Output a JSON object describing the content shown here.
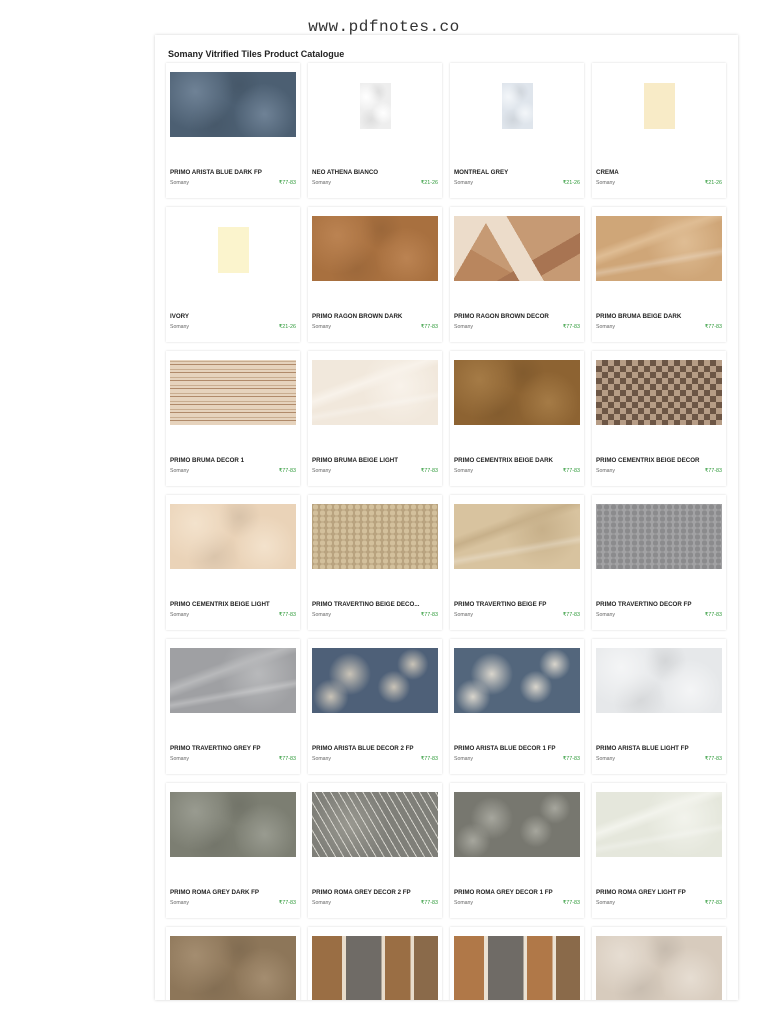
{
  "watermark": "www.pdfnotes.co",
  "catalogue_title": "Somany Vitrified Tiles Product Catalogue",
  "products": [
    {
      "name": "PRIMO ARISTA BLUE DARK FP",
      "brand": "Somany",
      "price": "₹77-83",
      "tile": {
        "size": "large",
        "base": "#4c5f72",
        "accent": "#6f8296",
        "pattern": "mottled"
      }
    },
    {
      "name": "NEO ATHENA BIANCO",
      "brand": "Somany",
      "price": "₹21-26",
      "tile": {
        "size": "small",
        "base": "#eeeeee",
        "accent": "#ffffff",
        "pattern": "mottled"
      }
    },
    {
      "name": "MONTREAL GREY",
      "brand": "Somany",
      "price": "₹21-26",
      "tile": {
        "size": "small",
        "base": "#dfe5ec",
        "accent": "#f3f6f9",
        "pattern": "mottled"
      }
    },
    {
      "name": "CREMA",
      "brand": "Somany",
      "price": "₹21-26",
      "tile": {
        "size": "small",
        "base": "#f8ebc7",
        "accent": "#fbf2d9",
        "pattern": "plain"
      }
    },
    {
      "name": "IVORY",
      "brand": "Somany",
      "price": "₹21-26",
      "tile": {
        "size": "small",
        "base": "#fbf4cd",
        "accent": "#fdf8e0",
        "pattern": "plain"
      }
    },
    {
      "name": "PRIMO RAGON BROWN DARK",
      "brand": "Somany",
      "price": "₹77-83",
      "tile": {
        "size": "large",
        "base": "#a8703f",
        "accent": "#bb8352",
        "pattern": "mottled"
      }
    },
    {
      "name": "PRIMO RAGON BROWN DECOR",
      "brand": "Somany",
      "price": "₹77-83",
      "tile": {
        "size": "large",
        "base": "#c69a74",
        "accent": "#ecdcca",
        "pattern": "geometric"
      }
    },
    {
      "name": "PRIMO BRUMA BEIGE DARK",
      "brand": "Somany",
      "price": "₹77-83",
      "tile": {
        "size": "large",
        "base": "#cfa678",
        "accent": "#dfbd94",
        "pattern": "veined"
      }
    },
    {
      "name": "PRIMO BRUMA DECOR 1",
      "brand": "Somany",
      "price": "₹77-83",
      "tile": {
        "size": "large",
        "base": "#e6d3bd",
        "accent": "#b08a6a",
        "pattern": "stripes"
      }
    },
    {
      "name": "PRIMO BRUMA BEIGE LIGHT",
      "brand": "Somany",
      "price": "₹77-83",
      "tile": {
        "size": "large",
        "base": "#f1e8dc",
        "accent": "#f8f2ea",
        "pattern": "veined"
      }
    },
    {
      "name": "PRIMO CEMENTRIX BEIGE DARK",
      "brand": "Somany",
      "price": "₹77-83",
      "tile": {
        "size": "large",
        "base": "#8d6332",
        "accent": "#a57b46",
        "pattern": "mottled"
      }
    },
    {
      "name": "PRIMO CEMENTRIX BEIGE DECOR",
      "brand": "Somany",
      "price": "₹77-83",
      "tile": {
        "size": "large",
        "base": "#b79d86",
        "accent": "#6d5645",
        "pattern": "checker"
      }
    },
    {
      "name": "PRIMO CEMENTRIX BEIGE LIGHT",
      "brand": "Somany",
      "price": "₹77-83",
      "tile": {
        "size": "large",
        "base": "#ead3b8",
        "accent": "#f3e2cc",
        "pattern": "mottled"
      }
    },
    {
      "name": "PRIMO TRAVERTINO BEIGE DECO...",
      "brand": "Somany",
      "price": "₹77-83",
      "tile": {
        "size": "large",
        "base": "#d3c09c",
        "accent": "#b9a37f",
        "pattern": "pebble"
      }
    },
    {
      "name": "PRIMO TRAVERTINO BEIGE FP",
      "brand": "Somany",
      "price": "₹77-83",
      "tile": {
        "size": "large",
        "base": "#d8c39f",
        "accent": "#c7b08a",
        "pattern": "veined"
      }
    },
    {
      "name": "PRIMO TRAVERTINO DECOR FP",
      "brand": "Somany",
      "price": "₹77-83",
      "tile": {
        "size": "large",
        "base": "#8b8b8d",
        "accent": "#a2a2a4",
        "pattern": "pebble"
      }
    },
    {
      "name": "PRIMO TRAVERTINO GREY FP",
      "brand": "Somany",
      "price": "₹77-83",
      "tile": {
        "size": "large",
        "base": "#9fa0a3",
        "accent": "#b8b9bb",
        "pattern": "veined"
      }
    },
    {
      "name": "PRIMO ARISTA BLUE DECOR 2 FP",
      "brand": "Somany",
      "price": "₹77-83",
      "tile": {
        "size": "large",
        "base": "#4e6078",
        "accent": "#c9c3b7",
        "pattern": "floral"
      }
    },
    {
      "name": "PRIMO ARISTA BLUE DECOR 1 FP",
      "brand": "Somany",
      "price": "₹77-83",
      "tile": {
        "size": "large",
        "base": "#53667c",
        "accent": "#d9d5cc",
        "pattern": "floral"
      }
    },
    {
      "name": "PRIMO ARISTA BLUE LIGHT FP",
      "brand": "Somany",
      "price": "₹77-83",
      "tile": {
        "size": "large",
        "base": "#e6e8ea",
        "accent": "#f4f5f6",
        "pattern": "mottled"
      }
    },
    {
      "name": "PRIMO ROMA GREY DARK FP",
      "brand": "Somany",
      "price": "₹77-83",
      "tile": {
        "size": "large",
        "base": "#7c7e72",
        "accent": "#999b90",
        "pattern": "mottled"
      }
    },
    {
      "name": "PRIMO ROMA GREY DECOR 2 FP",
      "brand": "Somany",
      "price": "₹77-83",
      "tile": {
        "size": "large",
        "base": "#7f7f79",
        "accent": "#d6d4cd",
        "pattern": "stripes-diag"
      }
    },
    {
      "name": "PRIMO ROMA GREY DECOR 1 FP",
      "brand": "Somany",
      "price": "₹77-83",
      "tile": {
        "size": "large",
        "base": "#77776f",
        "accent": "#a6a69d",
        "pattern": "floral"
      }
    },
    {
      "name": "PRIMO ROMA GREY LIGHT FP",
      "brand": "Somany",
      "price": "₹77-83",
      "tile": {
        "size": "large",
        "base": "#e5e7dc",
        "accent": "#f2f3ec",
        "pattern": "veined"
      }
    },
    {
      "name": "",
      "brand": "",
      "price": "",
      "tile": {
        "size": "large",
        "base": "#8d7659",
        "accent": "#a48d70",
        "pattern": "mottled"
      }
    },
    {
      "name": "",
      "brand": "",
      "price": "",
      "tile": {
        "size": "large",
        "base": "#9a6e44",
        "accent": "#e8dccb",
        "pattern": "panels"
      }
    },
    {
      "name": "",
      "brand": "",
      "price": "",
      "tile": {
        "size": "large",
        "base": "#b07848",
        "accent": "#ebe1d2",
        "pattern": "panels"
      }
    },
    {
      "name": "",
      "brand": "",
      "price": "",
      "tile": {
        "size": "large",
        "base": "#d7cbbd",
        "accent": "#e6ddd2",
        "pattern": "mottled"
      }
    }
  ]
}
